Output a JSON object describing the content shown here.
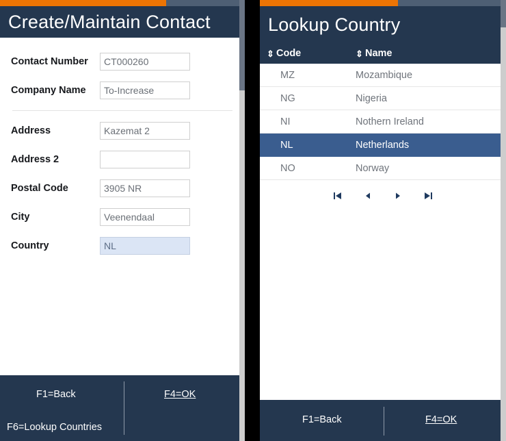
{
  "left_panel": {
    "progress_percent": 68,
    "accent_color": "#ec7404",
    "header_color": "#24374f",
    "title": "Create/Maintain Contact",
    "fields": [
      {
        "label": "Contact Number",
        "value": "CT000260",
        "placeholder": "",
        "focused": false
      },
      {
        "label": "Company Name",
        "value": "To-Increase",
        "placeholder": "",
        "focused": false
      },
      {
        "label": "Address",
        "value": "Kazemat 2",
        "placeholder": "",
        "focused": false
      },
      {
        "label": "Address 2",
        "value": "",
        "placeholder": "",
        "focused": false
      },
      {
        "label": "Postal Code",
        "value": "3905 NR",
        "placeholder": "",
        "focused": false
      },
      {
        "label": "City",
        "value": "Veenendaal",
        "placeholder": "",
        "focused": false
      },
      {
        "label": "Country",
        "value": "NL",
        "placeholder": "",
        "focused": true
      }
    ],
    "footer": {
      "back_label": "F1=Back",
      "ok_label": "F4=OK",
      "lookup_label": "F6=Lookup Countries"
    }
  },
  "right_panel": {
    "progress_percent": 56,
    "accent_color": "#ec7404",
    "header_color": "#24374f",
    "title": "Lookup Country",
    "table": {
      "columns": [
        {
          "label": "Code",
          "sort_icon": "sort-updown-icon"
        },
        {
          "label": "Name",
          "sort_icon": "sort-updown-icon"
        }
      ],
      "rows": [
        {
          "code": "MZ",
          "name": "Mozambique",
          "selected": false
        },
        {
          "code": "NG",
          "name": "Nigeria",
          "selected": false
        },
        {
          "code": "NI",
          "name": "Nothern Ireland",
          "selected": false
        },
        {
          "code": "NL",
          "name": "Netherlands",
          "selected": true
        },
        {
          "code": "NO",
          "name": "Norway",
          "selected": false
        }
      ],
      "selected_color": "#3a5d8f"
    },
    "pagination": {
      "first_label": "first-page",
      "prev_label": "previous-page",
      "next_label": "next-page",
      "last_label": "last-page"
    },
    "footer": {
      "back_label": "F1=Back",
      "ok_label": "F4=OK"
    }
  }
}
